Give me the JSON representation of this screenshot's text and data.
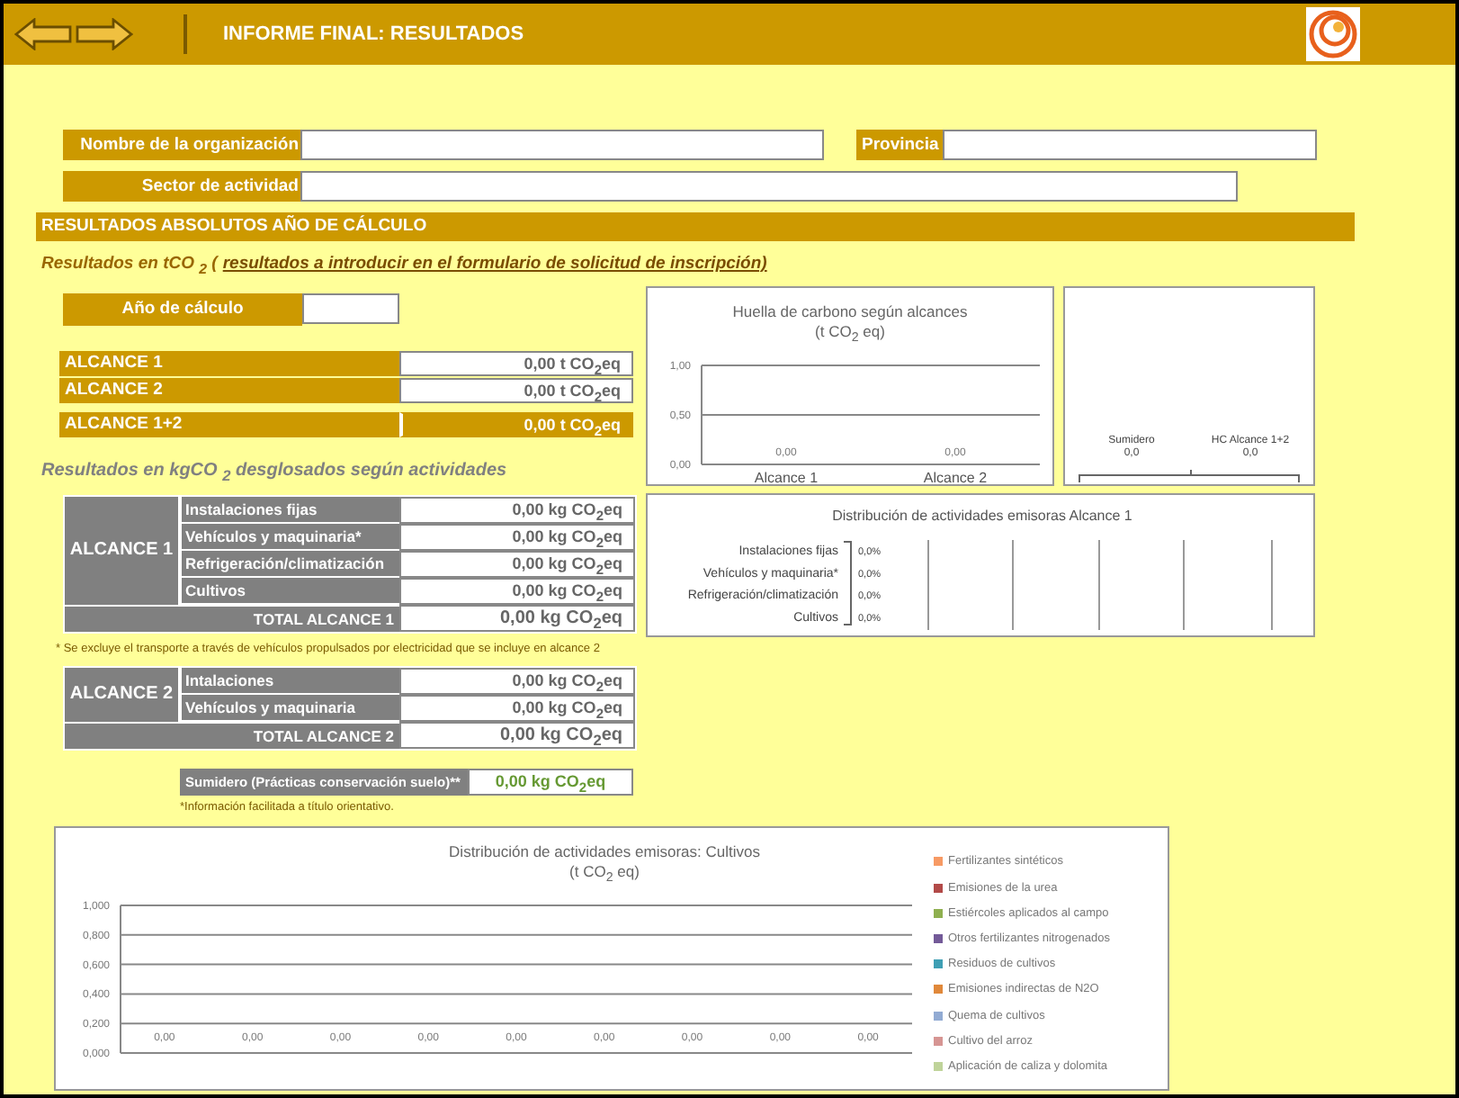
{
  "header": {
    "title": "INFORME FINAL: RESULTADOS"
  },
  "organization": {
    "fields": [
      {
        "label": "Nombre de la organización"
      },
      {
        "label": "Provincia"
      },
      {
        "label": "Sector de actividad"
      }
    ]
  },
  "section_title": "RESULTADOS ABSOLUTOS AÑO DE CÁLCULO",
  "results_t": {
    "heading": "Resultados en tCO $_{2}$ (",
    "heading_link": "resultados a introducir en el formulario de solicitud de inscripción)",
    "year_label": "Año  de cálculo",
    "rows": [
      {
        "label": "ALCANCE 1",
        "value": "0,00 t CO$_{2}$eq",
        "kind": "plain"
      },
      {
        "label": "ALCANCE 2",
        "value": "0,00  t CO$_{2}$eq",
        "kind": "plain"
      },
      {
        "label": "ALCANCE 1+2",
        "value": "0,00  t CO$_{2}$eq",
        "kind": "total"
      }
    ]
  },
  "results_kg": {
    "heading": "Resultados en kgCO $_{2}$ desglosados según actividades",
    "groups": [
      {
        "label": "ALCANCE 1",
        "rows": [
          {
            "label": "Instalaciones fijas",
            "value": "0,00 kg CO$_{2}$eq"
          },
          {
            "label": "Vehículos y maquinaria*",
            "value": "0,00 kg CO$_{2}$eq"
          },
          {
            "label": "Refrigeración/climatización",
            "value": "0,00 kg CO$_{2}$eq"
          },
          {
            "label": "Cultivos",
            "value": "0,00 kg CO$_{2}$eq"
          }
        ],
        "total_label": "TOTAL ALCANCE 1",
        "total_value": "0,00 kg CO$_{2}$eq",
        "footnote": "* Se excluye el transporte a través de vehículos propulsados por electricidad que se incluye en alcance 2"
      },
      {
        "label": "ALCANCE 2",
        "rows": [
          {
            "label": "Intalaciones",
            "value": "0,00 kg CO$_{2}$eq"
          },
          {
            "label": "Vehículos y maquinaria",
            "value": "0,00 kg CO$_{2}$eq"
          }
        ],
        "total_label": "TOTAL ALCANCE 2",
        "total_value": "0,00 kg CO$_{2}$eq"
      }
    ]
  },
  "sink": {
    "label": "Sumidero (Prácticas conservación suelo)**",
    "value": "0,00 kg CO$_{2}$eq",
    "note": "*Información facilitada a título orientativo."
  },
  "carbon_chart": {
    "chart_data": {
      "type": "bar",
      "title": "Huella de carbono según alcances",
      "subtitle": "(t CO$_{2}$ eq)",
      "categories": [
        "Alcance 1",
        "Alcance 2"
      ],
      "values": [
        0,
        0
      ],
      "ylim": [
        0,
        1
      ],
      "yticks": [
        {
          "value": 0,
          "label": "0,00"
        },
        {
          "value": 0.5,
          "label": "0,50"
        },
        {
          "value": 1,
          "label": "1,00"
        }
      ],
      "data_labels": true,
      "value_labels": [
        "0,00",
        "0,00"
      ]
    }
  },
  "sink_chart": {
    "items": [
      {
        "label": "Sumidero",
        "value": "0,0"
      },
      {
        "label": "HC Alcance 1+2",
        "value": "0,0"
      }
    ]
  },
  "scope1_chart": {
    "title": "Distribución de actividades emisoras  Alcance 1",
    "rows": [
      {
        "label": "Instalaciones fijas",
        "value": "0,0%"
      },
      {
        "label": "Vehículos y maquinaria*",
        "value": "0,0%"
      },
      {
        "label": "Refrigeración/climatización",
        "value": "0,0%"
      },
      {
        "label": "Cultivos",
        "value": "0,0%"
      }
    ]
  },
  "crops_chart": {
    "chart_data": {
      "type": "bar",
      "title": "Distribución de actividades emisoras: Cultivos",
      "subtitle": "(t CO$_{2}$ eq)",
      "categories": [
        null,
        null,
        null,
        null,
        null,
        null,
        null,
        null,
        null
      ],
      "grid": true,
      "ylim": [
        0,
        1
      ],
      "yticks": [
        {
          "value": 0,
          "label": "0,000"
        },
        {
          "value": 0.2,
          "label": "0,200"
        },
        {
          "value": 0.4,
          "label": "0,400"
        },
        {
          "value": 0.6,
          "label": "0,600"
        },
        {
          "value": 0.8,
          "label": "0,800"
        },
        {
          "value": 1,
          "label": "1,000"
        }
      ],
      "data_labels": true,
      "series": [
        {
          "values": [
            0,
            0,
            0,
            0,
            0,
            0,
            0,
            0,
            0
          ],
          "value_labels": [
            "0,00",
            "0,00",
            "0,00",
            "0,00",
            "0,00",
            "0,00",
            "0,00",
            "0,00",
            "0,00"
          ]
        }
      ]
    },
    "legend": [
      {
        "name": "Fertilizantes sintéticos",
        "color": "#f79a64"
      },
      {
        "name": "Emisiones de la urea",
        "color": "#b24a48"
      },
      {
        "name": "Estiércoles aplicados al campo",
        "color": "#8fb050"
      },
      {
        "name": "Otros fertilizantes nitrogenados",
        "color": "#735a98"
      },
      {
        "name": "Residuos de cultivos",
        "color": "#3f9fb4"
      },
      {
        "name": "Emisiones indirectas de N2O",
        "color": "#e0883a"
      },
      {
        "name": "Quema de cultivos",
        "color": "#92abd3"
      },
      {
        "name": "Cultivo del arroz",
        "color": "#d69593"
      },
      {
        "name": "Aplicación de caliza y dolomita",
        "color": "#bfd39a"
      }
    ]
  }
}
